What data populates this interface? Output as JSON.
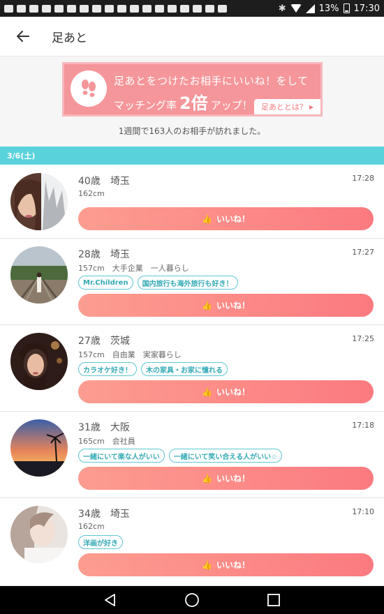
{
  "status_bar": {
    "battery": "13%",
    "time": "17:30"
  },
  "app_bar": {
    "title": "足あと"
  },
  "banner": {
    "line1": "足あとをつけたお相手にいいね！をして",
    "line2_pre": "マッチング率",
    "line2_big": "2倍",
    "line2_post": "アップ！",
    "link_label": "足あととは？"
  },
  "visit_count_text": "1週間で163人のお相手が訪れました。",
  "date_header": "3/6(土)",
  "like_label": "いいね！",
  "visitors": [
    {
      "name": "40歳　埼玉",
      "info": "162cm",
      "time": "17:28",
      "tags": [],
      "avatar": "avatar-woman-hair"
    },
    {
      "name": "28歳　埼玉",
      "info": "157cm　大手企業　一人暮らし",
      "time": "17:27",
      "tags": [
        "Mr.Children",
        "国内旅行も海外旅行も好き！"
      ],
      "avatar": "avatar-railway"
    },
    {
      "name": "27歳　茨城",
      "info": "157cm　自由業　実家暮らし",
      "time": "17:25",
      "tags": [
        "カラオケ好き！",
        "木の家具・お家に憧れる"
      ],
      "avatar": "avatar-woman-portrait"
    },
    {
      "name": "31歳　大阪",
      "info": "165cm　会社員",
      "time": "17:18",
      "tags": [
        "一緒にいて楽な人がいい",
        "一緒にいて笑い合える人がいい☆"
      ],
      "avatar": "avatar-sunset"
    },
    {
      "name": "34歳　埼玉",
      "info": "162cm",
      "time": "17:10",
      "tags": [
        "洋画が好き"
      ],
      "avatar": "avatar-woman-soft"
    }
  ],
  "colors": {
    "accent_teal": "#5ad2dc",
    "like_gradient_start": "#fc9d90",
    "like_gradient_end": "#fb7a80",
    "banner_pink": "#f5969a"
  }
}
